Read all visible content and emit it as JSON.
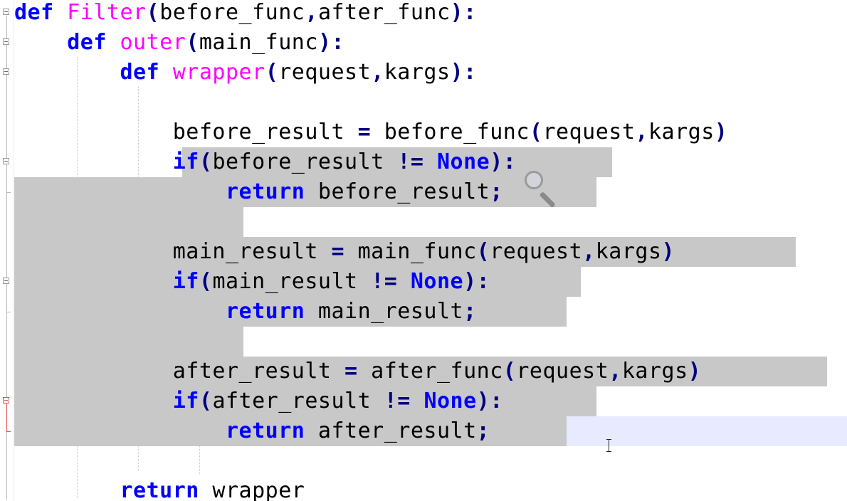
{
  "editor": {
    "lines": [
      {
        "tokens": [
          {
            "t": "kw",
            "v": "def"
          },
          {
            "t": "txt",
            "v": " "
          },
          {
            "t": "fn",
            "v": "Filter"
          },
          {
            "t": "op",
            "v": "("
          },
          {
            "t": "txt",
            "v": "before_func"
          },
          {
            "t": "op",
            "v": ","
          },
          {
            "t": "txt",
            "v": "after_func"
          },
          {
            "t": "op",
            "v": "):"
          }
        ]
      },
      {
        "tokens": [
          {
            "t": "txt",
            "v": "    "
          },
          {
            "t": "kw",
            "v": "def"
          },
          {
            "t": "txt",
            "v": " "
          },
          {
            "t": "fn",
            "v": "outer"
          },
          {
            "t": "op",
            "v": "("
          },
          {
            "t": "txt",
            "v": "main_func"
          },
          {
            "t": "op",
            "v": "):"
          }
        ]
      },
      {
        "tokens": [
          {
            "t": "txt",
            "v": "        "
          },
          {
            "t": "kw",
            "v": "def"
          },
          {
            "t": "txt",
            "v": " "
          },
          {
            "t": "fn",
            "v": "wrapper"
          },
          {
            "t": "op",
            "v": "("
          },
          {
            "t": "txt",
            "v": "request"
          },
          {
            "t": "op",
            "v": ","
          },
          {
            "t": "txt",
            "v": "kargs"
          },
          {
            "t": "op",
            "v": "):"
          }
        ]
      },
      {
        "tokens": []
      },
      {
        "tokens": [
          {
            "t": "txt",
            "v": "            before_result "
          },
          {
            "t": "op",
            "v": "="
          },
          {
            "t": "txt",
            "v": " before_func"
          },
          {
            "t": "op",
            "v": "("
          },
          {
            "t": "txt",
            "v": "request"
          },
          {
            "t": "op",
            "v": ","
          },
          {
            "t": "txt",
            "v": "kargs"
          },
          {
            "t": "op",
            "v": ")"
          }
        ]
      },
      {
        "tokens": [
          {
            "t": "txt",
            "v": "            "
          },
          {
            "t": "kw",
            "v": "if"
          },
          {
            "t": "op",
            "v": "("
          },
          {
            "t": "txt",
            "v": "before_result "
          },
          {
            "t": "op",
            "v": "!="
          },
          {
            "t": "txt",
            "v": " "
          },
          {
            "t": "kw",
            "v": "None"
          },
          {
            "t": "op",
            "v": "):"
          }
        ]
      },
      {
        "tokens": [
          {
            "t": "txt",
            "v": "                "
          },
          {
            "t": "kw",
            "v": "return"
          },
          {
            "t": "txt",
            "v": " before_result"
          },
          {
            "t": "op",
            "v": ";"
          }
        ]
      },
      {
        "tokens": []
      },
      {
        "tokens": [
          {
            "t": "txt",
            "v": "            main_result "
          },
          {
            "t": "op",
            "v": "="
          },
          {
            "t": "txt",
            "v": " main_func"
          },
          {
            "t": "op",
            "v": "("
          },
          {
            "t": "txt",
            "v": "request"
          },
          {
            "t": "op",
            "v": ","
          },
          {
            "t": "txt",
            "v": "kargs"
          },
          {
            "t": "op",
            "v": ")"
          }
        ]
      },
      {
        "tokens": [
          {
            "t": "txt",
            "v": "            "
          },
          {
            "t": "kw",
            "v": "if"
          },
          {
            "t": "op",
            "v": "("
          },
          {
            "t": "txt",
            "v": "main_result "
          },
          {
            "t": "op",
            "v": "!="
          },
          {
            "t": "txt",
            "v": " "
          },
          {
            "t": "kw",
            "v": "None"
          },
          {
            "t": "op",
            "v": "):"
          }
        ]
      },
      {
        "tokens": [
          {
            "t": "txt",
            "v": "                "
          },
          {
            "t": "kw",
            "v": "return"
          },
          {
            "t": "txt",
            "v": " main_result"
          },
          {
            "t": "op",
            "v": ";"
          }
        ]
      },
      {
        "tokens": []
      },
      {
        "tokens": [
          {
            "t": "txt",
            "v": "            after_result "
          },
          {
            "t": "op",
            "v": "="
          },
          {
            "t": "txt",
            "v": " after_func"
          },
          {
            "t": "op",
            "v": "("
          },
          {
            "t": "txt",
            "v": "request"
          },
          {
            "t": "op",
            "v": ","
          },
          {
            "t": "txt",
            "v": "kargs"
          },
          {
            "t": "op",
            "v": ")"
          }
        ]
      },
      {
        "tokens": [
          {
            "t": "txt",
            "v": "            "
          },
          {
            "t": "kw",
            "v": "if"
          },
          {
            "t": "op",
            "v": "("
          },
          {
            "t": "txt",
            "v": "after_result "
          },
          {
            "t": "op",
            "v": "!="
          },
          {
            "t": "txt",
            "v": " "
          },
          {
            "t": "kw",
            "v": "None"
          },
          {
            "t": "op",
            "v": "):"
          }
        ]
      },
      {
        "tokens": [
          {
            "t": "txt",
            "v": "                "
          },
          {
            "t": "kw",
            "v": "return"
          },
          {
            "t": "txt",
            "v": " after_result"
          },
          {
            "t": "op",
            "v": ";"
          }
        ]
      },
      {
        "tokens": []
      },
      {
        "tokens": [
          {
            "t": "txt",
            "v": "        "
          },
          {
            "t": "kw",
            "v": "return"
          },
          {
            "t": "txt",
            "v": " wrapper"
          }
        ]
      }
    ]
  },
  "colors": {
    "keyword": "#0000ff",
    "function_name": "#ff00ff",
    "operator": "#000080",
    "selection": "#c8c8c8",
    "caret_line": "#e8eaff"
  },
  "icons": {
    "magnifier": "magnifier-icon",
    "text_cursor": "ibeam-cursor-icon"
  }
}
